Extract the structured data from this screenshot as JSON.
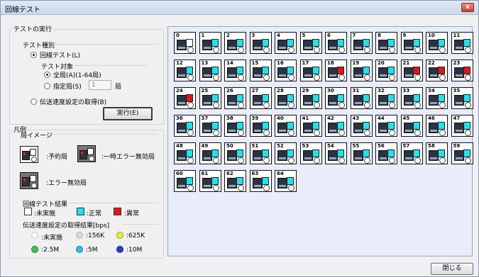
{
  "window": {
    "title": "回線テスト",
    "close_icon": "close-icon",
    "close_label": "x"
  },
  "exec_group": {
    "title": "テストの実行",
    "test_type_title": "テスト種別",
    "radio_line_test": "回線テスト(L)",
    "target_title": "テスト対象",
    "radio_all": "全局(A)(1-64局)",
    "radio_specified": "指定局(S)",
    "specified_value": "1",
    "specified_unit": "局",
    "radio_speed": "伝送速度設定の取得(B)",
    "run_button": "実行(E)"
  },
  "legend_group": {
    "title": "凡例",
    "station_image_title": "局イメージ",
    "reserved": ":予約局",
    "temp_error_disabled": ":一時エラー無効局",
    "error_disabled": ":エラー無効局",
    "result_title": "回線テスト結果",
    "not_run": ":未実施",
    "normal": ":正常",
    "abnormal": ":異常",
    "speed_title": "伝送速度設定の取得結果[bps]",
    "speeds": [
      ":未実施",
      ":156K",
      ":625K",
      ":2.5M",
      ":5M",
      ":10M"
    ]
  },
  "colors": {
    "normal": "#21e2ee",
    "abnormal": "#e0141e",
    "not_run": "#ffffff",
    "speed_not_run": "#f5f5f5",
    "speed_156k": "#d8d8d8",
    "speed_625k": "#e8ee3a",
    "speed_2_5m": "#3bc35a",
    "speed_5m": "#2dbfe5",
    "speed_10m": "#2a3fc8"
  },
  "stations": [
    {
      "num": "0",
      "status": "not_run"
    },
    {
      "num": "1",
      "status": "normal"
    },
    {
      "num": "2",
      "status": "normal"
    },
    {
      "num": "3",
      "status": "normal"
    },
    {
      "num": "4",
      "status": "normal"
    },
    {
      "num": "5",
      "status": "normal"
    },
    {
      "num": "6",
      "status": "normal"
    },
    {
      "num": "7",
      "status": "normal"
    },
    {
      "num": "8",
      "status": "normal"
    },
    {
      "num": "9",
      "status": "normal"
    },
    {
      "num": "10",
      "status": "normal"
    },
    {
      "num": "11",
      "status": "normal"
    },
    {
      "num": "12",
      "status": "normal"
    },
    {
      "num": "13",
      "status": "normal"
    },
    {
      "num": "14",
      "status": "normal"
    },
    {
      "num": "15",
      "status": "normal"
    },
    {
      "num": "16",
      "status": "normal"
    },
    {
      "num": "17",
      "status": "normal"
    },
    {
      "num": "18",
      "status": "abnormal"
    },
    {
      "num": "19",
      "status": "normal"
    },
    {
      "num": "20",
      "status": "normal"
    },
    {
      "num": "21",
      "status": "abnormal"
    },
    {
      "num": "22",
      "status": "abnormal"
    },
    {
      "num": "23",
      "status": "abnormal"
    },
    {
      "num": "24",
      "status": "abnormal"
    },
    {
      "num": "25",
      "status": "normal"
    },
    {
      "num": "26",
      "status": "normal"
    },
    {
      "num": "27",
      "status": "normal"
    },
    {
      "num": "28",
      "status": "normal"
    },
    {
      "num": "29",
      "status": "normal"
    },
    {
      "num": "30",
      "status": "normal"
    },
    {
      "num": "31",
      "status": "normal"
    },
    {
      "num": "32",
      "status": "normal"
    },
    {
      "num": "33",
      "status": "normal"
    },
    {
      "num": "34",
      "status": "normal"
    },
    {
      "num": "35",
      "status": "normal"
    },
    {
      "num": "36",
      "status": "normal"
    },
    {
      "num": "37",
      "status": "normal"
    },
    {
      "num": "38",
      "status": "normal"
    },
    {
      "num": "39",
      "status": "normal"
    },
    {
      "num": "40",
      "status": "normal"
    },
    {
      "num": "41",
      "status": "normal"
    },
    {
      "num": "42",
      "status": "normal"
    },
    {
      "num": "43",
      "status": "normal"
    },
    {
      "num": "44",
      "status": "normal"
    },
    {
      "num": "45",
      "status": "normal"
    },
    {
      "num": "46",
      "status": "normal"
    },
    {
      "num": "47",
      "status": "normal"
    },
    {
      "num": "48",
      "status": "normal"
    },
    {
      "num": "49",
      "status": "normal"
    },
    {
      "num": "50",
      "status": "normal"
    },
    {
      "num": "51",
      "status": "normal"
    },
    {
      "num": "52",
      "status": "normal"
    },
    {
      "num": "53",
      "status": "normal"
    },
    {
      "num": "54",
      "status": "normal"
    },
    {
      "num": "55",
      "status": "normal"
    },
    {
      "num": "56",
      "status": "normal"
    },
    {
      "num": "57",
      "status": "normal"
    },
    {
      "num": "58",
      "status": "normal"
    },
    {
      "num": "59",
      "status": "normal"
    },
    {
      "num": "60",
      "status": "normal"
    },
    {
      "num": "61",
      "status": "normal"
    },
    {
      "num": "62",
      "status": "normal"
    },
    {
      "num": "63",
      "status": "normal"
    },
    {
      "num": "64",
      "status": "normal"
    }
  ],
  "footer": {
    "close_button": "閉じる"
  }
}
